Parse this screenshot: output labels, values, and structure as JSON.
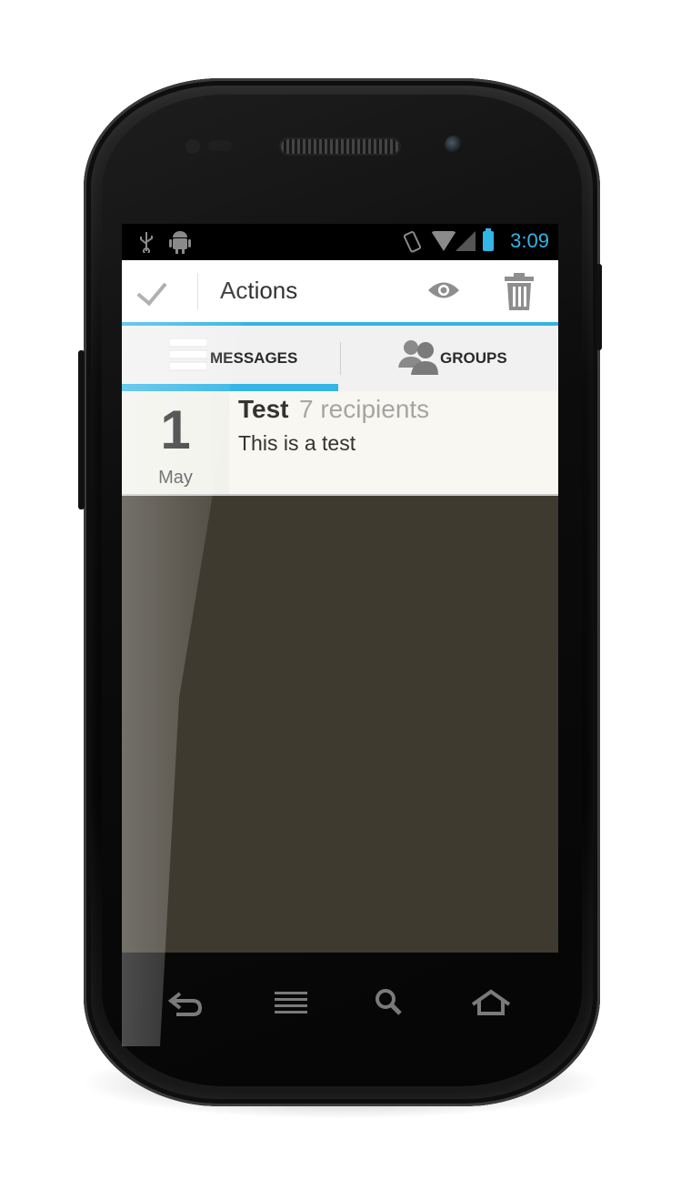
{
  "status_bar": {
    "time": "3:09",
    "icons": [
      "usb-icon",
      "android-debug-icon",
      "vibrate-icon",
      "wifi-icon",
      "signal-icon",
      "battery-charging-icon"
    ],
    "accent_color": "#33b5e5"
  },
  "action_bar": {
    "done_icon": "check-icon",
    "title": "Actions",
    "actions": [
      "eye-icon",
      "trash-icon"
    ]
  },
  "tabs": [
    {
      "label": "MESSAGES",
      "icon": "list-icon",
      "selected": true
    },
    {
      "label": "GROUPS",
      "icon": "people-icon",
      "selected": false
    }
  ],
  "messages": [
    {
      "day": "1",
      "month": "May",
      "title": "Test",
      "recipients": "7 recipients",
      "body": "This is a test"
    }
  ],
  "nav_bar": {
    "icons": [
      "back-icon",
      "menu-icon",
      "search-icon",
      "home-icon"
    ]
  }
}
